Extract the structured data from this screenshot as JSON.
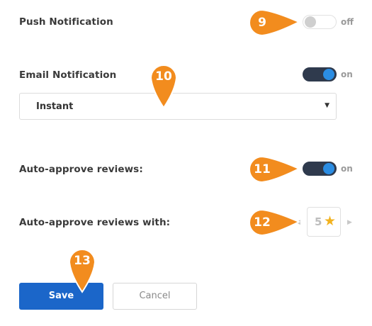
{
  "settings": {
    "push": {
      "label": "Push Notification",
      "state": "off",
      "state_label": "off"
    },
    "email": {
      "label": "Email Notification",
      "state": "on",
      "state_label": "on",
      "frequency": "Instant"
    },
    "auto_approve": {
      "label": "Auto-approve reviews:",
      "state": "on",
      "state_label": "on"
    },
    "auto_approve_with": {
      "label": "Auto-approve reviews with:",
      "value": "5",
      "icon": "star-icon"
    }
  },
  "actions": {
    "save_label": "Save",
    "cancel_label": "Cancel"
  },
  "callouts": [
    "9",
    "10",
    "11",
    "12",
    "13"
  ],
  "colors": {
    "accent": "#1b66c9",
    "toggle_knob_on": "#2b8de3",
    "toggle_track_on": "#2f3a4d",
    "callout": "#f28c1e",
    "star": "#f2b21f"
  }
}
